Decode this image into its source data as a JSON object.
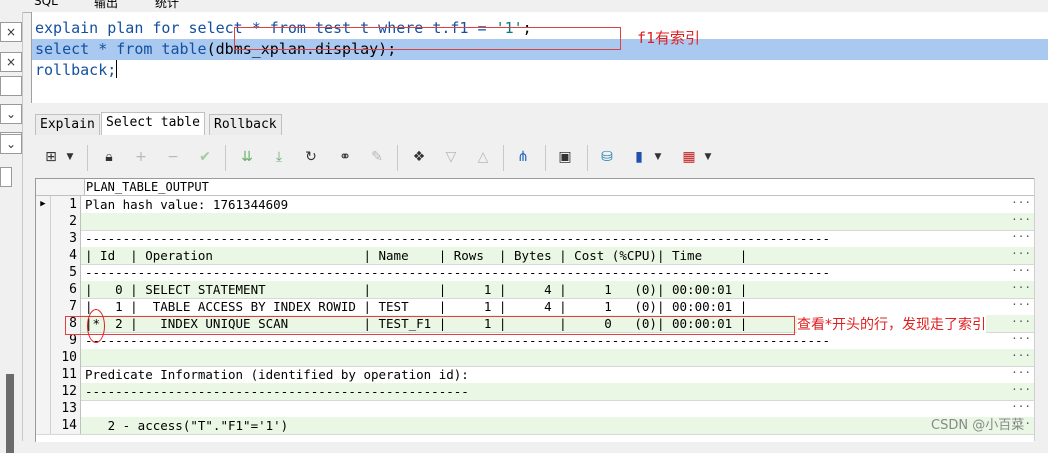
{
  "top_tabs": [
    "SQL",
    "输出",
    "统计"
  ],
  "left_buttons": [
    "×",
    "×",
    "",
    "⌄",
    "",
    "⌄",
    "⌄"
  ],
  "editor": {
    "line1": {
      "kw1": "explain plan for ",
      "boxed_a": "select * from test t where t.f1 = ",
      "str": "'1'",
      "boxed_b": ";"
    },
    "line2": {
      "p1": "select * from table",
      "p2": "(dbms_xplan.display);"
    },
    "line3": "rollback;",
    "annotation": "f1有索引"
  },
  "subtabs": [
    "Explain",
    "Select table",
    "Rollback"
  ],
  "toolbar": {
    "icons": [
      "grid-icon",
      "dropdown-icon",
      "lock-icon",
      "plus-icon",
      "minus-icon",
      "check-icon",
      "arrow-down-double-icon",
      "arrow-down-end-icon",
      "refresh-icon",
      "binoculars-icon",
      "eraser-icon",
      "wizard-icon",
      "triangle-down-icon",
      "triangle-up-icon",
      "network-icon",
      "save-icon",
      "db-icon",
      "chart-icon",
      "dropdown-icon",
      "table-icon",
      "dropdown-icon"
    ]
  },
  "grid": {
    "column": "PLAN_TABLE_OUTPUT",
    "current_row": 1,
    "rows": [
      {
        "n": "1",
        "text": "Plan hash value: 1761344609"
      },
      {
        "n": "2",
        "text": ""
      },
      {
        "n": "3",
        "text": "---------------------------------------------------------------------------------------------------"
      },
      {
        "n": "4",
        "text": "| Id  | Operation                    | Name    | Rows  | Bytes | Cost (%CPU)| Time     |"
      },
      {
        "n": "5",
        "text": "---------------------------------------------------------------------------------------------------"
      },
      {
        "n": "6",
        "text": "|   0 | SELECT STATEMENT             |         |     1 |     4 |     1   (0)| 00:00:01 |"
      },
      {
        "n": "7",
        "text": "|   1 |  TABLE ACCESS BY INDEX ROWID | TEST    |     1 |     4 |     1   (0)| 00:00:01 |"
      },
      {
        "n": "8",
        "text": "|*  2 |   INDEX UNIQUE SCAN          | TEST_F1 |     1 |       |     0   (0)| 00:00:01 |"
      },
      {
        "n": "9",
        "text": "---------------------------------------------------------------------------------------------------"
      },
      {
        "n": "10",
        "text": ""
      },
      {
        "n": "11",
        "text": "Predicate Information (identified by operation id):"
      },
      {
        "n": "12",
        "text": "---------------------------------------------------"
      },
      {
        "n": "13",
        "text": ""
      },
      {
        "n": "14",
        "text": "   2 - access(\"T\".\"F1\"='1')"
      }
    ],
    "annotation": "查看*开头的行，发现走了索引"
  },
  "watermark": "CSDN @小百菜"
}
